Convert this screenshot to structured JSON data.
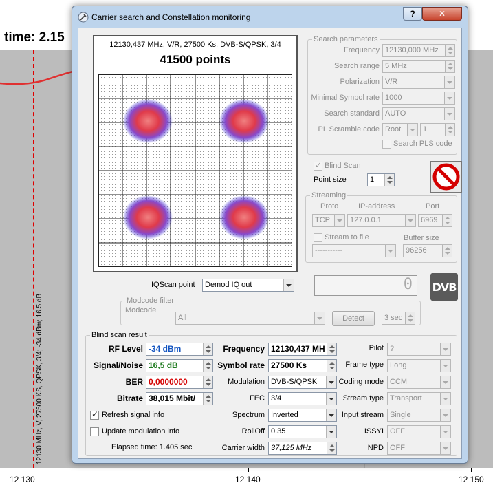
{
  "background": {
    "header_text": "time: 2.15",
    "marker_label": "12130 MHz, V, 27500 KS, QPSK, 3/4; -34 dBm; 16.5 dB",
    "axis_ticks": [
      "12 130",
      "12 140",
      "12 150"
    ]
  },
  "window": {
    "title": "Carrier search and Constellation monitoring",
    "help_label": "?",
    "close_label": "✕"
  },
  "constellation": {
    "info": "12130,437 MHz, V/R, 27500 Ks, DVB-S/QPSK, 3/4",
    "points_label": "41500 points"
  },
  "search_params": {
    "title": "Search parameters",
    "frequency_label": "Frequency",
    "frequency_value": "12130,000 MHz",
    "range_label": "Search range",
    "range_value": "5 MHz",
    "polarization_label": "Polarization",
    "polarization_value": "V/R",
    "min_sr_label": "Minimal Symbol rate",
    "min_sr_value": "1000",
    "standard_label": "Search standard",
    "standard_value": "AUTO",
    "pls_label": "PL Scramble code",
    "pls_mode_value": "Root",
    "pls_value": "1",
    "search_pls_label": "Search PLS code"
  },
  "blind_scan": {
    "checkbox_label": "Blind Scan",
    "point_size_label": "Point size",
    "point_size_value": "1"
  },
  "streaming": {
    "title": "Streaming",
    "proto_label": "Proto",
    "proto_value": "TCP",
    "ip_label": "IP-address",
    "ip_value": "127.0.0.1",
    "port_label": "Port",
    "port_value": "6969",
    "stream_to_file_label": "Stream to file",
    "file_value": "-----------",
    "buffer_label": "Buffer size",
    "buffer_value": "96256"
  },
  "iq": {
    "label": "IQScan point",
    "value": "Demod IQ out",
    "lcd_value": "0"
  },
  "modcode": {
    "title": "Modcode filter",
    "label": "Modcode",
    "value": "All",
    "detect_label": "Detect",
    "time_value": "3 sec"
  },
  "result": {
    "title": "Blind scan result",
    "rf_label": "RF Level",
    "rf_value": "-34 dBm",
    "sn_label": "Signal/Noise",
    "sn_value": "16,5 dB",
    "ber_label": "BER",
    "ber_value": "0,0000000",
    "bitrate_label": "Bitrate",
    "bitrate_value": "38,015 Mbit/",
    "refresh_label": "Refresh signal info",
    "update_mod_label": "Update modulation info",
    "elapsed_label": "Elapsed time: 1.405 sec",
    "frequency_label": "Frequency",
    "frequency_value": "12130,437 MH",
    "sr_label": "Symbol rate",
    "sr_value": "27500 Ks",
    "modulation_label": "Modulation",
    "modulation_value": "DVB-S/QPSK",
    "fec_label": "FEC",
    "fec_value": "3/4",
    "spectrum_label": "Spectrum",
    "spectrum_value": "Inverted",
    "rolloff_label": "RollOff",
    "rolloff_value": "0.35",
    "carrier_width_label": "Carrier width",
    "carrier_width_value": "37,125 MHz",
    "pilot_label": "Pilot",
    "pilot_value": "?",
    "frame_label": "Frame type",
    "frame_value": "Long",
    "coding_label": "Coding mode",
    "coding_value": "CCM",
    "stream_type_label": "Stream type",
    "stream_type_value": "Transport",
    "input_stream_label": "Input stream",
    "input_stream_value": "Single",
    "issyi_label": "ISSYI",
    "issyi_value": "OFF",
    "npd_label": "NPD",
    "npd_value": "OFF"
  },
  "colors": {
    "window_frame": "#bdd4ec",
    "close_button": "#c7432c",
    "marker": "#e00000",
    "constellation_core": "#e03030",
    "constellation_edge": "#2020d0"
  },
  "icons": [
    "app-icon",
    "stop-icon",
    "dvb-logo"
  ]
}
